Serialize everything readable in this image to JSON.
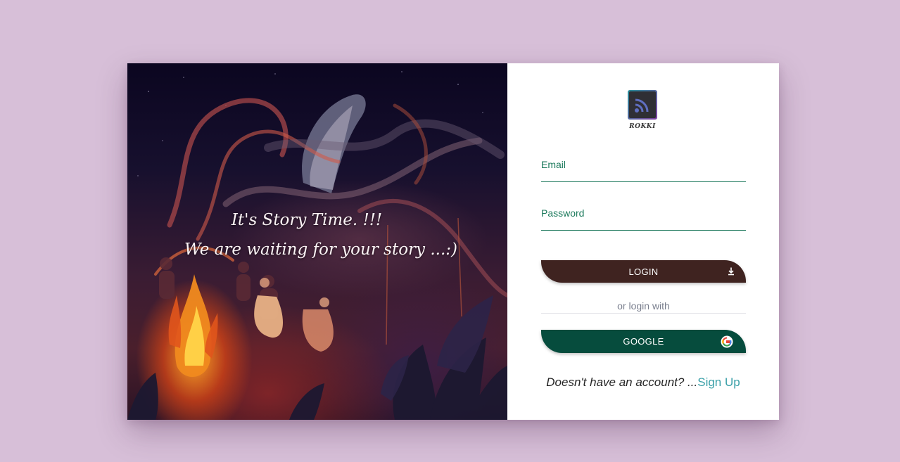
{
  "hero": {
    "line1": "It's Story Time. !!!",
    "line2": "We are waiting for your story ...:)"
  },
  "brand": {
    "name": "ROKKI",
    "icon": "rss-icon"
  },
  "form": {
    "email_label": "Email",
    "password_label": "Password",
    "login_label": "LOGIN",
    "login_icon": "download-icon",
    "divider_text": "or login with",
    "google_label": "GOOGLE",
    "google_icon": "google-icon"
  },
  "signup": {
    "question": "Doesn't have an account? ...",
    "link": "Sign Up"
  },
  "colors": {
    "background": "#d7bfd8",
    "accent": "#1c7a5c",
    "login_button": "#3f2320",
    "google_button": "#064c3d",
    "link": "#3aa0a8"
  }
}
